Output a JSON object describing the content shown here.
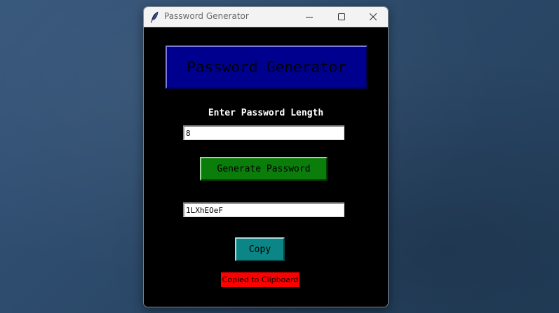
{
  "window": {
    "title": "Password Generator",
    "icon": "feather-icon"
  },
  "app": {
    "header_title": "Password Generator",
    "length_label": "Enter Password Length",
    "length_value": "8",
    "generate_label": "Generate Password",
    "password_value": "1LXhEOeF",
    "copy_label": "Copy",
    "status_text": "Copied to Clipboard"
  },
  "colors": {
    "header_bg": "#00008f",
    "generate_bg": "#0a7d0a",
    "copy_bg": "#0b8585",
    "status_bg": "#ff0000",
    "window_bg": "#000000",
    "desktop_bg": "#2b4868"
  }
}
